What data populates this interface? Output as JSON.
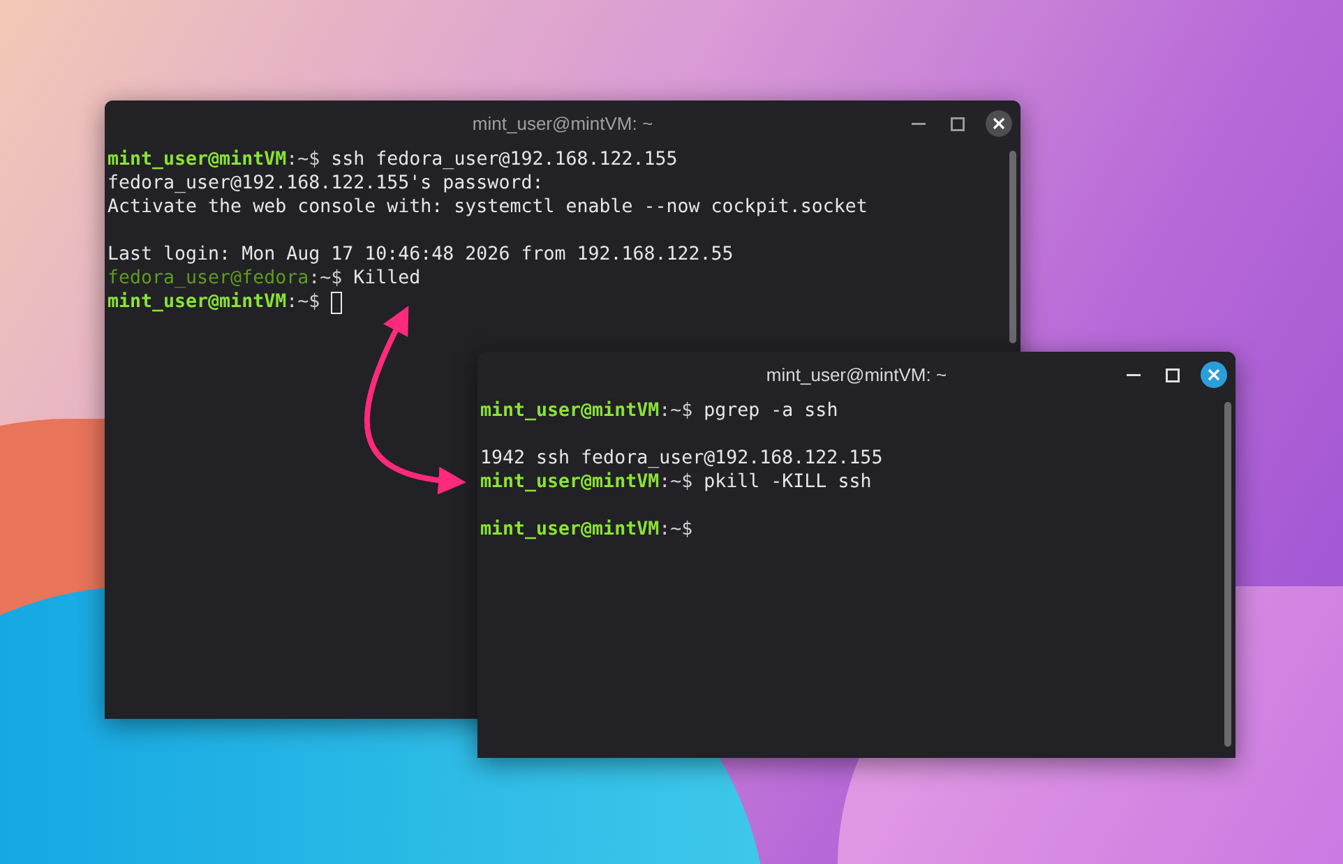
{
  "windows": [
    {
      "title": "mint_user@mintVM: ~",
      "active": false,
      "lines": [
        {
          "kind": "prompt",
          "host": "mint_user@mintVM",
          "remote": false,
          "rest": ":~$",
          "command": "ssh fedora_user@192.168.122.155",
          "cursor": false
        },
        {
          "kind": "output",
          "text": "fedora_user@192.168.122.155's password:"
        },
        {
          "kind": "output",
          "text": "Activate the web console with: systemctl enable --now cockpit.socket"
        },
        {
          "kind": "blank"
        },
        {
          "kind": "output",
          "text": "Last login: Mon Aug 17 10:46:48 2026 from 192.168.122.55"
        },
        {
          "kind": "prompt",
          "host": "fedora_user@fedora",
          "remote": true,
          "rest": ":~$",
          "command": "Killed",
          "cursor": false
        },
        {
          "kind": "prompt",
          "host": "mint_user@mintVM",
          "remote": false,
          "rest": ":~$",
          "cursor": true
        }
      ]
    },
    {
      "title": "mint_user@mintVM: ~",
      "active": true,
      "lines": [
        {
          "kind": "prompt",
          "host": "mint_user@mintVM",
          "remote": false,
          "rest": ":~$",
          "command": "pgrep -a ssh",
          "cursor": false
        },
        {
          "kind": "blank"
        },
        {
          "kind": "output",
          "text": "1942 ssh fedora_user@192.168.122.155"
        },
        {
          "kind": "prompt",
          "host": "mint_user@mintVM",
          "remote": false,
          "rest": ":~$",
          "command": "pkill -KILL ssh",
          "cursor": false
        },
        {
          "kind": "blank"
        },
        {
          "kind": "prompt",
          "host": "mint_user@mintVM",
          "remote": false,
          "rest": ":~$",
          "cursor": false
        }
      ]
    }
  ]
}
